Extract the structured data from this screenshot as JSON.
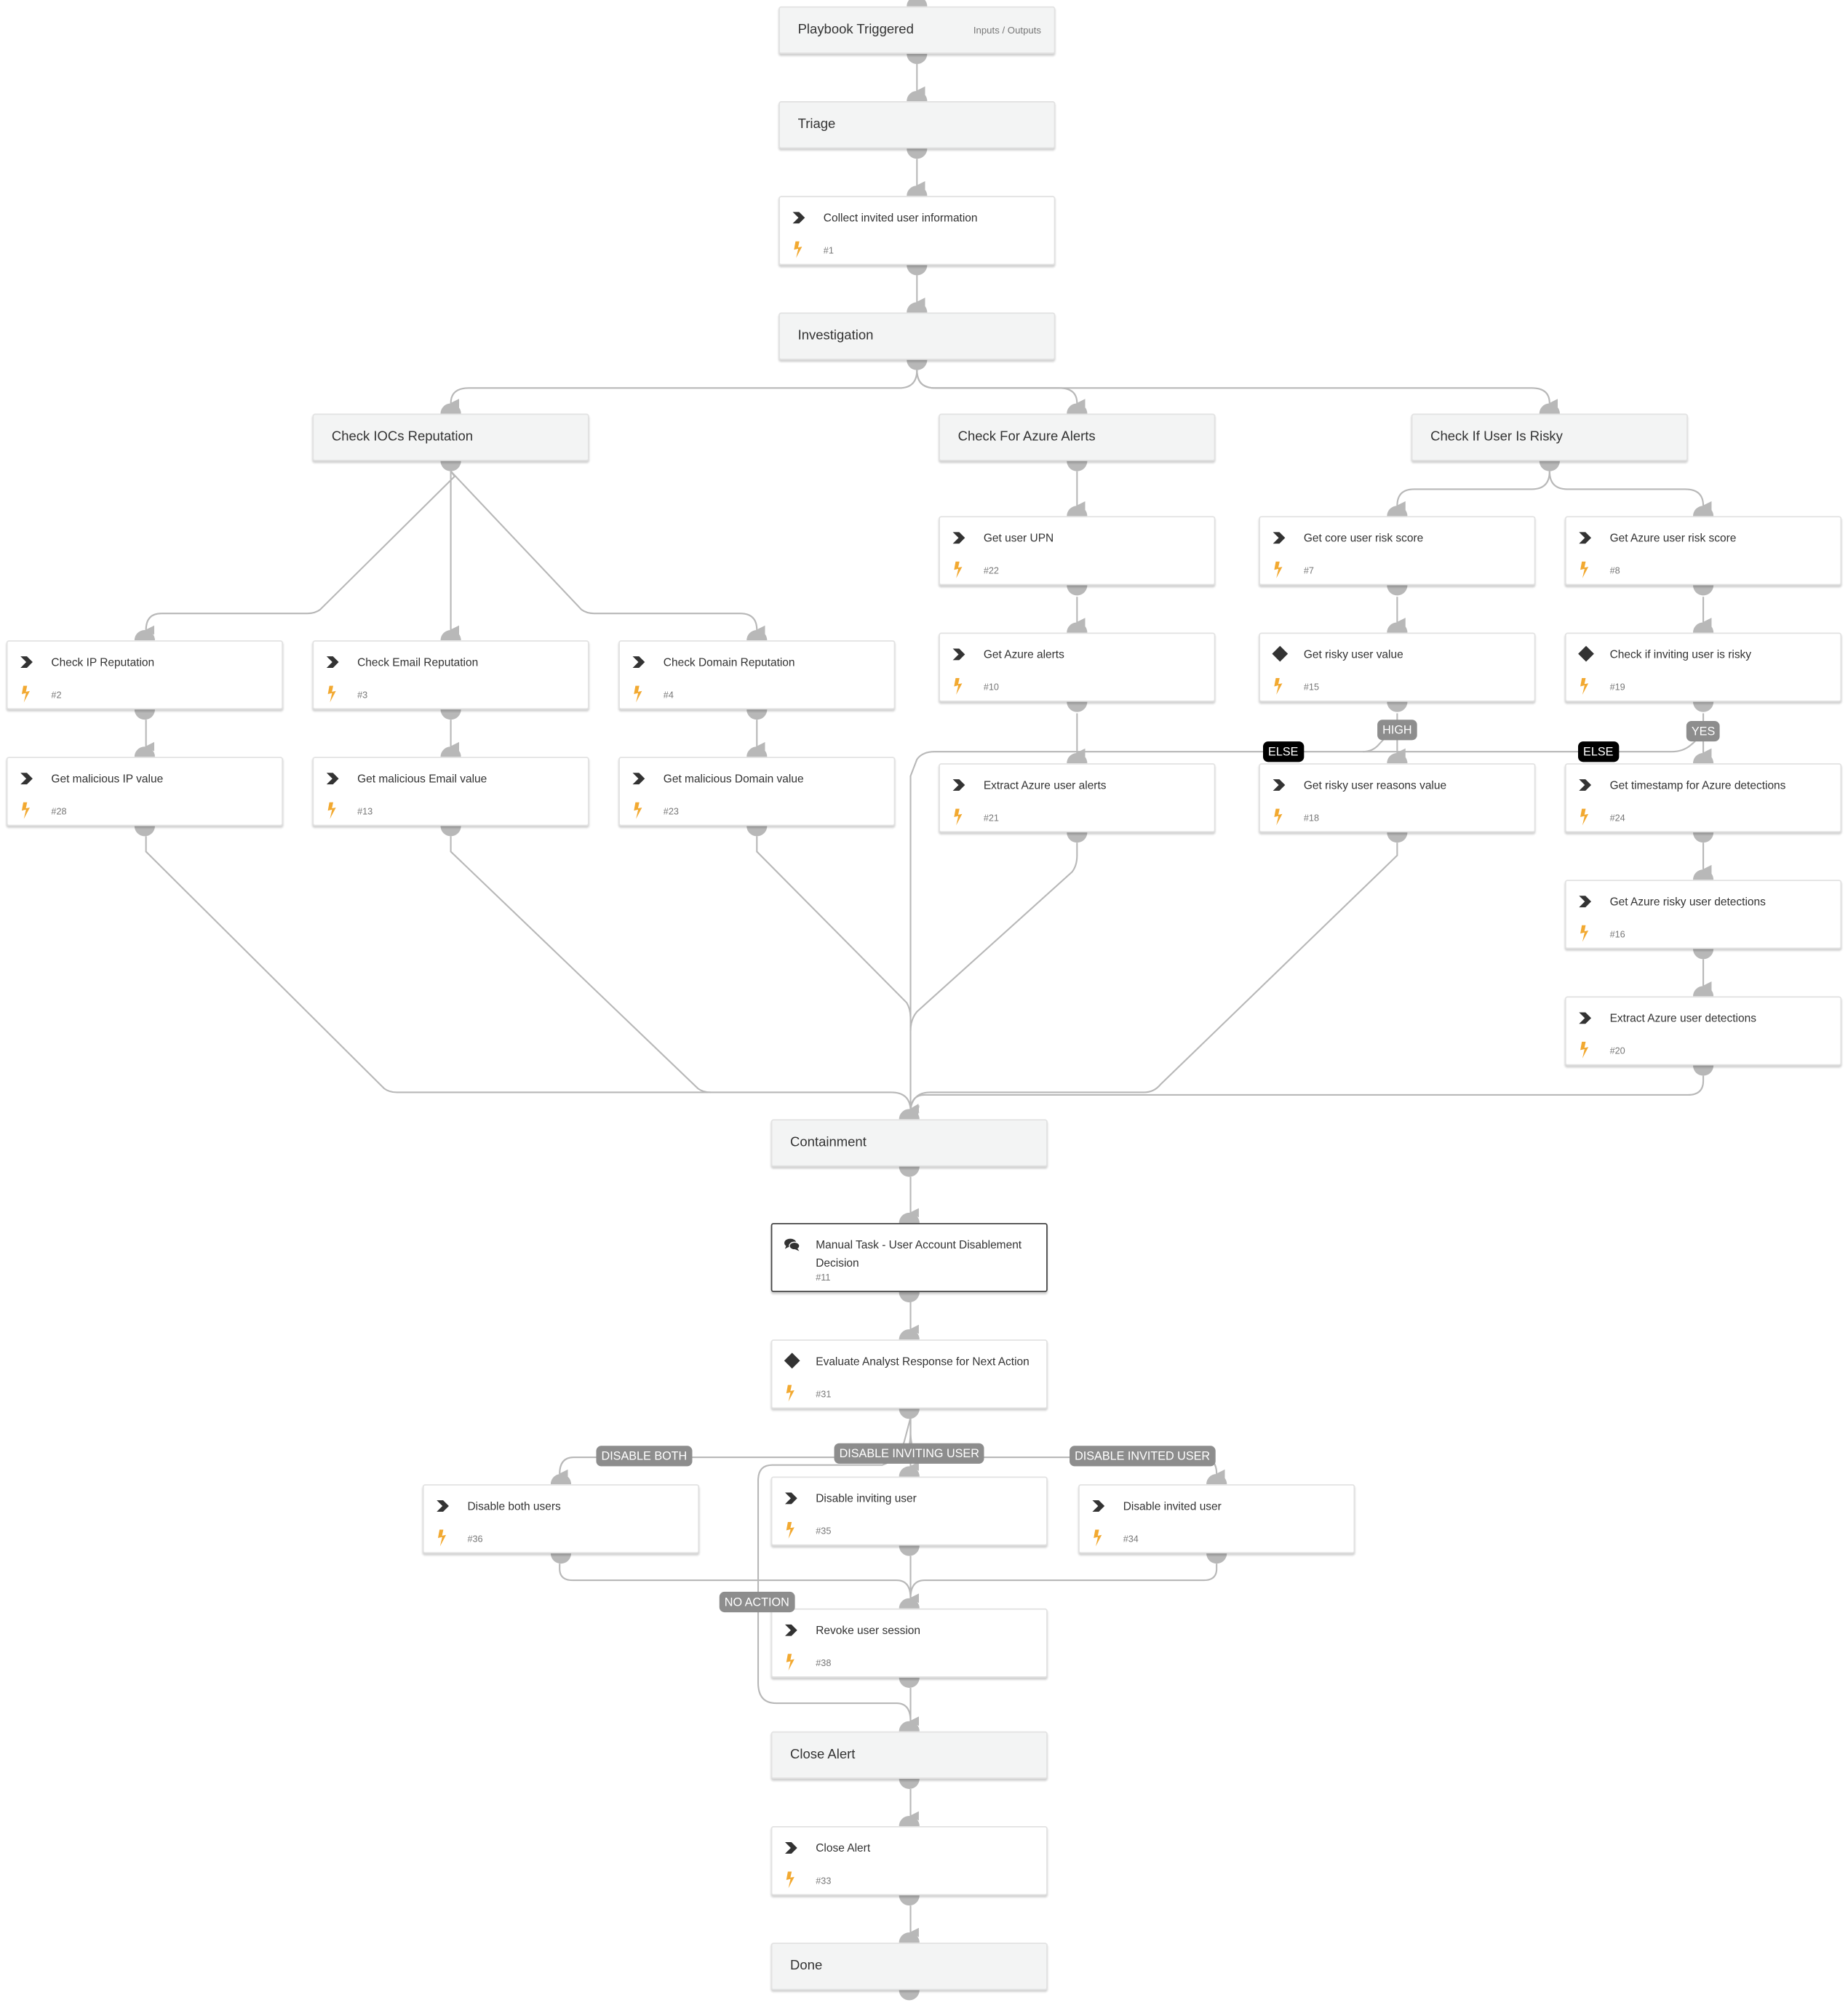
{
  "colors": {
    "section_bg": "#f3f4f4",
    "edge": "#b8b8b8",
    "bolt": "#f2a931",
    "icon": "#333333",
    "pill": "#8d8d8d",
    "pill_else": "#000000"
  },
  "sections": [
    {
      "id": "start",
      "title": "Playbook Triggered",
      "aux": "Inputs / Outputs"
    },
    {
      "id": "triage",
      "title": "Triage"
    },
    {
      "id": "investigation",
      "title": "Investigation"
    },
    {
      "id": "iocs",
      "title": "Check IOCs Reputation"
    },
    {
      "id": "azure-alerts",
      "title": "Check For Azure Alerts"
    },
    {
      "id": "risky",
      "title": "Check If User Is Risky"
    },
    {
      "id": "containment",
      "title": "Containment"
    },
    {
      "id": "close-alert-section",
      "title": "Close Alert"
    },
    {
      "id": "done",
      "title": "Done"
    }
  ],
  "tasks": [
    {
      "id": "t1",
      "label": "Collect invited user information",
      "num": "#1",
      "type": "playbook"
    },
    {
      "id": "t2",
      "label": "Check IP Reputation",
      "num": "#2",
      "type": "playbook"
    },
    {
      "id": "t3",
      "label": "Check Email Reputation",
      "num": "#3",
      "type": "playbook"
    },
    {
      "id": "t4",
      "label": "Check Domain Reputation",
      "num": "#4",
      "type": "playbook"
    },
    {
      "id": "t28",
      "label": "Get malicious IP value",
      "num": "#28",
      "type": "playbook"
    },
    {
      "id": "t13",
      "label": "Get malicious Email value",
      "num": "#13",
      "type": "playbook"
    },
    {
      "id": "t23",
      "label": "Get malicious Domain value",
      "num": "#23",
      "type": "playbook"
    },
    {
      "id": "t22",
      "label": "Get user UPN",
      "num": "#22",
      "type": "playbook"
    },
    {
      "id": "t10",
      "label": "Get Azure alerts",
      "num": "#10",
      "type": "playbook"
    },
    {
      "id": "t21",
      "label": "Extract Azure user alerts",
      "num": "#21",
      "type": "playbook"
    },
    {
      "id": "t7",
      "label": "Get core user risk score",
      "num": "#7",
      "type": "playbook"
    },
    {
      "id": "t15",
      "label": "Get risky user value",
      "num": "#15",
      "type": "condition"
    },
    {
      "id": "t18",
      "label": "Get risky user reasons value",
      "num": "#18",
      "type": "playbook"
    },
    {
      "id": "t8",
      "label": "Get Azure user risk score",
      "num": "#8",
      "type": "playbook"
    },
    {
      "id": "t19",
      "label": "Check if inviting user is risky",
      "num": "#19",
      "type": "condition"
    },
    {
      "id": "t24",
      "label": "Get timestamp for Azure detections",
      "num": "#24",
      "type": "playbook"
    },
    {
      "id": "t16",
      "label": "Get Azure risky user detections",
      "num": "#16",
      "type": "playbook"
    },
    {
      "id": "t20",
      "label": "Extract Azure user detections",
      "num": "#20",
      "type": "playbook"
    },
    {
      "id": "t11",
      "label": "Manual Task - User Account Disablement Decision",
      "num": "#11",
      "type": "manual"
    },
    {
      "id": "t31",
      "label": "Evaluate Analyst Response for Next Action",
      "num": "#31",
      "type": "condition"
    },
    {
      "id": "t36",
      "label": "Disable both users",
      "num": "#36",
      "type": "playbook"
    },
    {
      "id": "t35",
      "label": "Disable inviting user",
      "num": "#35",
      "type": "playbook"
    },
    {
      "id": "t34",
      "label": "Disable invited user",
      "num": "#34",
      "type": "playbook"
    },
    {
      "id": "t38",
      "label": "Revoke user session",
      "num": "#38",
      "type": "playbook"
    },
    {
      "id": "t33",
      "label": "Close Alert",
      "num": "#33",
      "type": "playbook"
    }
  ],
  "branch_labels": [
    {
      "id": "high",
      "text": "HIGH",
      "style": "grey"
    },
    {
      "id": "else15",
      "text": "ELSE",
      "style": "dark"
    },
    {
      "id": "yes",
      "text": "YES",
      "style": "grey"
    },
    {
      "id": "else19",
      "text": "ELSE",
      "style": "dark"
    },
    {
      "id": "disable-both",
      "text": "DISABLE BOTH",
      "style": "grey"
    },
    {
      "id": "disable-inviting",
      "text": "DISABLE INVITING USER",
      "style": "grey"
    },
    {
      "id": "disable-invited",
      "text": "DISABLE INVITED USER",
      "style": "grey"
    },
    {
      "id": "no-action",
      "text": "NO ACTION",
      "style": "grey"
    }
  ]
}
